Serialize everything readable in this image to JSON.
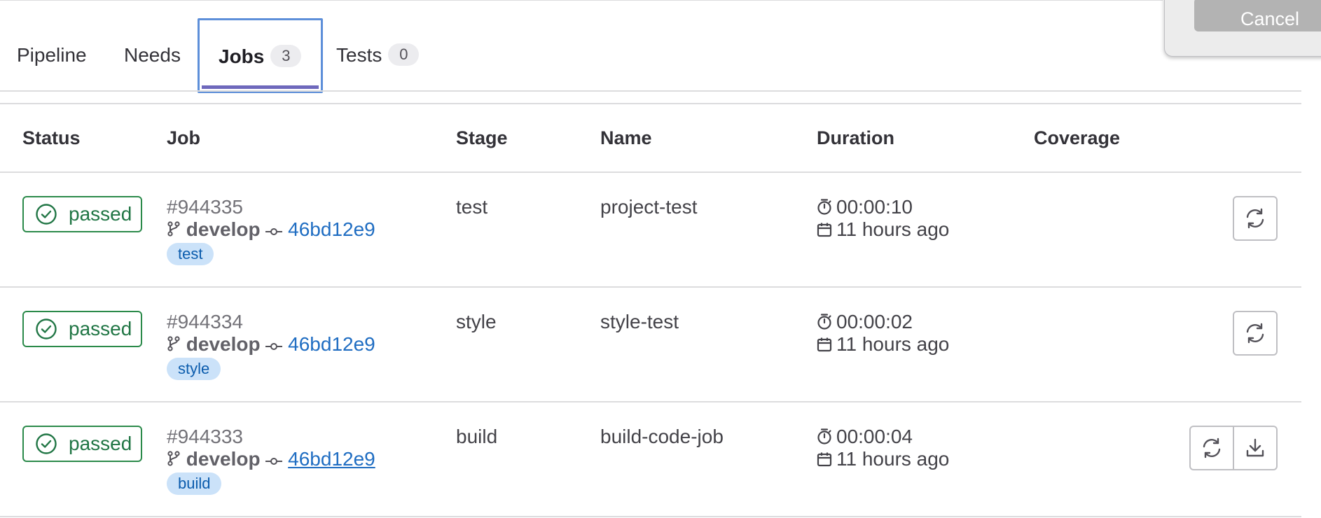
{
  "dialog": {
    "cancel_label": "Cancel"
  },
  "tabs": [
    {
      "label": "Pipeline"
    },
    {
      "label": "Needs"
    },
    {
      "label": "Jobs",
      "count": "3"
    },
    {
      "label": "Tests",
      "count": "0"
    }
  ],
  "table": {
    "columns": [
      "Status",
      "Job",
      "Stage",
      "Name",
      "Duration",
      "Coverage"
    ],
    "rows": [
      {
        "status": "passed",
        "job_id": "#944335",
        "branch": "develop",
        "sha": "46bd12e9",
        "stage_badge": "test",
        "stage": "test",
        "name": "project-test",
        "duration": "00:00:10",
        "finished": "11 hours ago"
      },
      {
        "status": "passed",
        "job_id": "#944334",
        "branch": "develop",
        "sha": "46bd12e9",
        "stage_badge": "style",
        "stage": "style",
        "name": "style-test",
        "duration": "00:00:02",
        "finished": "11 hours ago"
      },
      {
        "status": "passed",
        "job_id": "#944333",
        "branch": "develop",
        "sha": "46bd12e9",
        "stage_badge": "build",
        "stage": "build",
        "name": "build-code-job",
        "duration": "00:00:04",
        "finished": "11 hours ago"
      }
    ]
  },
  "colors": {
    "success": "#217645",
    "link": "#1f6dc2",
    "focus": "#5d8fd9",
    "tab_active": "#6e68bc",
    "badge_bg": "#cbe2f9"
  },
  "icons": [
    "status-success-icon",
    "branch-icon",
    "commit-icon",
    "timer-icon",
    "calendar-icon",
    "retry-icon",
    "download-icon"
  ]
}
